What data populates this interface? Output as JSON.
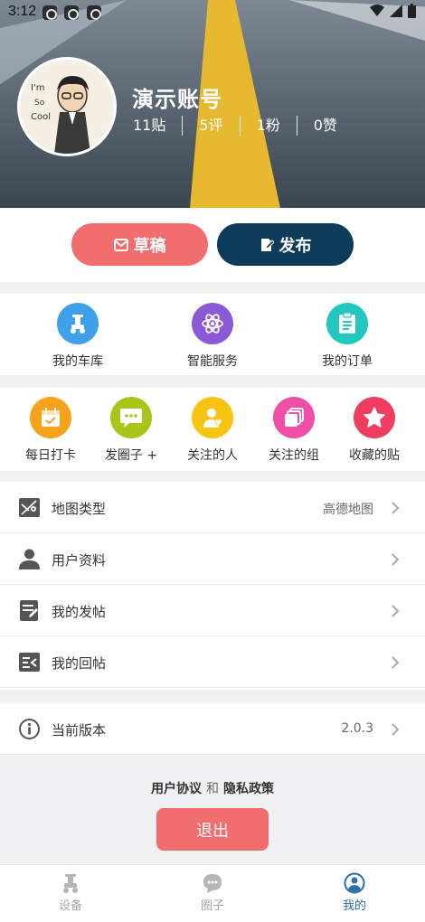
{
  "status_bar": {
    "time": "3:12",
    "notifications": [
      "app-notification-icon",
      "app-notification-icon",
      "app-notification-icon"
    ]
  },
  "profile": {
    "username": "演示账号",
    "stats": [
      {
        "label": "11贴"
      },
      {
        "label": "5评"
      },
      {
        "label": "1粉"
      },
      {
        "label": "0赞"
      }
    ]
  },
  "actions": {
    "draft_label": "草稿",
    "publish_label": "发布"
  },
  "grid_row1": [
    {
      "label": "我的车库",
      "icon": "scooter-icon",
      "color": "#3ea0ea"
    },
    {
      "label": "智能服务",
      "icon": "atom-icon",
      "color": "#8a5ad6"
    },
    {
      "label": "我的订单",
      "icon": "clipboard-icon",
      "color": "#22c8c0"
    }
  ],
  "grid_row2": [
    {
      "label": "每日打卡",
      "icon": "calendar-check-icon",
      "color": "#f7a21b"
    },
    {
      "label": "发圈子 +",
      "icon": "chat-bubble-icon",
      "color": "#a8c51a"
    },
    {
      "label": "关注的人",
      "icon": "person-heart-icon",
      "color": "#f8c414"
    },
    {
      "label": "关注的组",
      "icon": "stacked-squares-icon",
      "color": "#ef4fa7"
    },
    {
      "label": "收藏的贴",
      "icon": "star-icon",
      "color": "#ee3d5f"
    }
  ],
  "settings": [
    {
      "label": "地图类型",
      "value": "高德地图",
      "icon": "map-icon"
    },
    {
      "label": "用户资料",
      "value": "",
      "icon": "user-icon"
    },
    {
      "label": "我的发帖",
      "value": "",
      "icon": "edit-document-icon"
    },
    {
      "label": "我的回帖",
      "value": "",
      "icon": "reply-list-icon"
    }
  ],
  "version": {
    "label": "当前版本",
    "value": "2.0.3",
    "icon": "info-icon"
  },
  "agreement": {
    "user_agreement": "用户协议",
    "and": "和",
    "privacy_policy": "隐私政策"
  },
  "logout_label": "退出",
  "tabs": [
    {
      "label": "设备",
      "icon": "scooter-icon",
      "active": false
    },
    {
      "label": "圈子",
      "icon": "chat-icon",
      "active": false
    },
    {
      "label": "我的",
      "icon": "profile-icon",
      "active": true
    }
  ],
  "colors": {
    "accent_red": "#f26d6d",
    "accent_navy": "#0d3b5a",
    "tab_active": "#2b6ea8"
  }
}
